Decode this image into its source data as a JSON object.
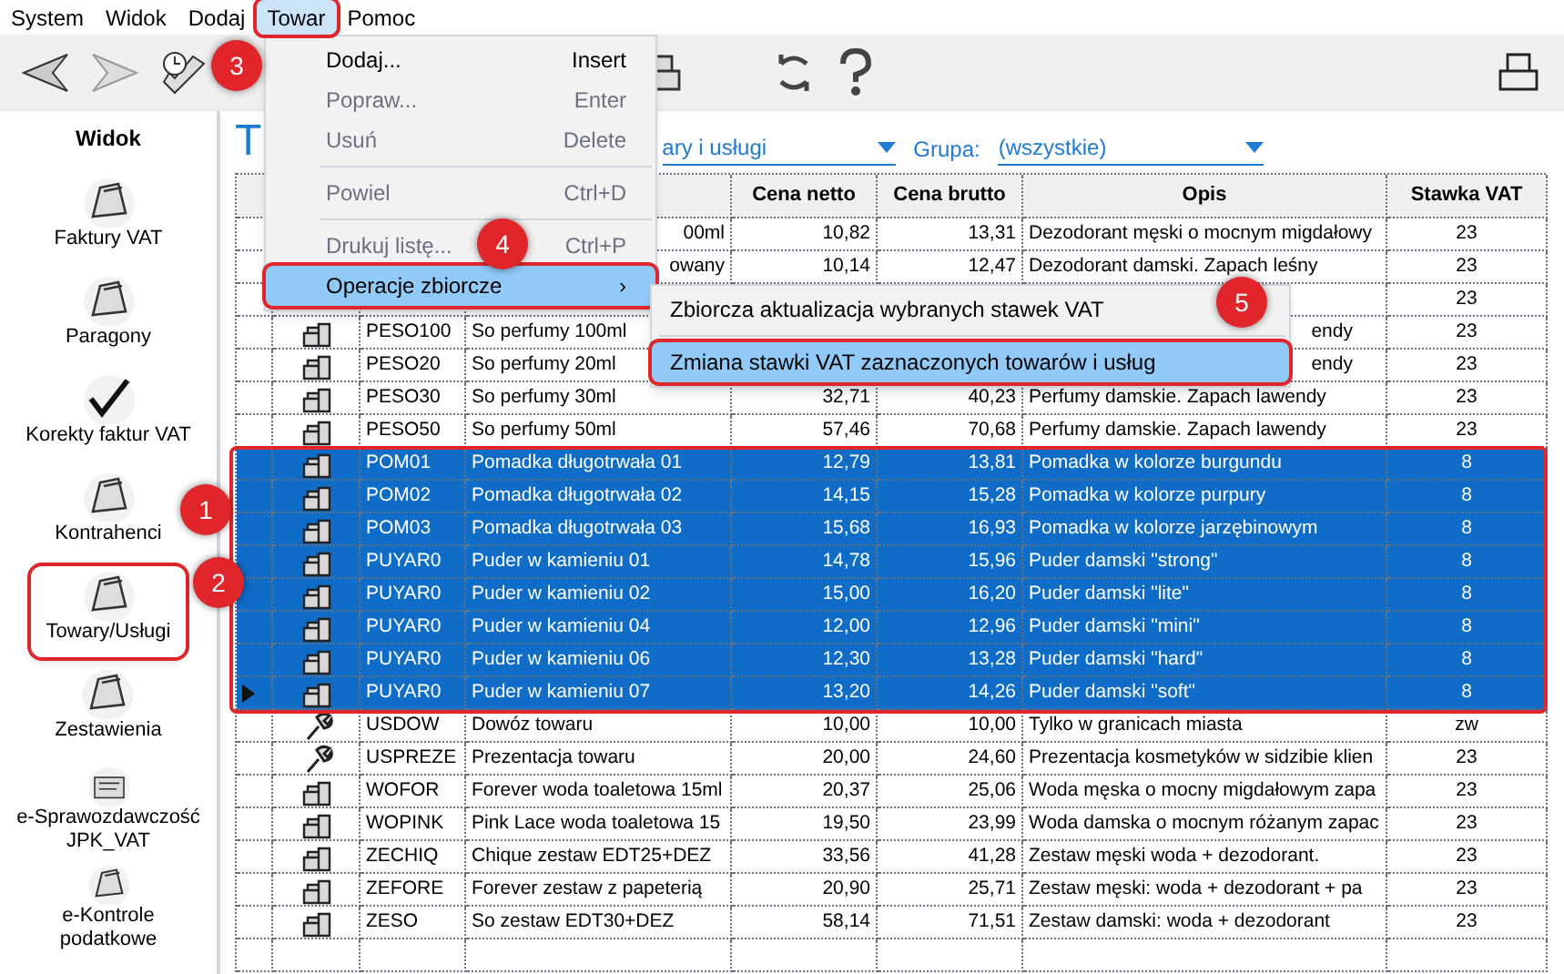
{
  "menubar": [
    {
      "label": "System",
      "selected": false
    },
    {
      "label": "Widok",
      "selected": false
    },
    {
      "label": "Dodaj",
      "selected": false
    },
    {
      "label": "Towar",
      "selected": true
    },
    {
      "label": "Pomoc",
      "selected": false
    }
  ],
  "sidebar": {
    "title": "Widok",
    "items": [
      {
        "label": "Faktury VAT",
        "selected": false
      },
      {
        "label": "Paragony",
        "selected": false
      },
      {
        "label": "Korekty faktur VAT",
        "selected": false
      },
      {
        "label": "Kontrahenci",
        "selected": false
      },
      {
        "label": "Towary/Usługi",
        "selected": true
      },
      {
        "label": "Zestawienia",
        "selected": false
      },
      {
        "label": "e-Sprawozdawczość JPK_VAT",
        "selected": false
      },
      {
        "label": "e-Kontrole podatkowe",
        "selected": false
      }
    ]
  },
  "view_title": "T",
  "filters": [
    {
      "value": "ary i usługi"
    },
    {
      "label": "Grupa:",
      "value": "(wszystkie)"
    }
  ],
  "table": {
    "columns": [
      "",
      "",
      "",
      "",
      "Cena netto",
      "Cena brutto",
      "Opis",
      "Stawka VAT"
    ],
    "rows": [
      {
        "name": "00ml",
        "netto": "10,82",
        "brutto": "13,31",
        "opis": "Dezodorant męski o mocnym migdałowy",
        "vat": "23",
        "selected": false,
        "current": false
      },
      {
        "name": "owany",
        "netto": "10,14",
        "brutto": "12,47",
        "opis": "Dezodorant damski. Zapach leśny",
        "vat": "23",
        "selected": false,
        "current": false
      },
      {
        "vat": "23",
        "selected": false,
        "current": false
      },
      {
        "kind": "product",
        "code": "PESO100",
        "name": "So perfumy 100ml",
        "opis": "endy",
        "vat": "23",
        "selected": false,
        "current": false
      },
      {
        "kind": "product",
        "code": "PESO20",
        "name": "So perfumy 20ml",
        "opis": "endy",
        "vat": "23",
        "selected": false,
        "current": false
      },
      {
        "kind": "product",
        "code": "PESO30",
        "name": "So perfumy 30ml",
        "netto": "32,71",
        "brutto": "40,23",
        "opis": "Perfumy damskie. Zapach lawendy",
        "vat": "23",
        "selected": false,
        "current": false
      },
      {
        "kind": "product",
        "code": "PESO50",
        "name": "So perfumy 50ml",
        "netto": "57,46",
        "brutto": "70,68",
        "opis": "Perfumy damskie. Zapach lawendy",
        "vat": "23",
        "selected": false,
        "current": false
      },
      {
        "kind": "product",
        "code": "POM01",
        "name": "Pomadka długotrwała 01",
        "netto": "12,79",
        "brutto": "13,81",
        "opis": "Pomadka w kolorze burgundu",
        "vat": "8",
        "selected": true,
        "current": false
      },
      {
        "kind": "product",
        "code": "POM02",
        "name": "Pomadka długotrwała 02",
        "netto": "14,15",
        "brutto": "15,28",
        "opis": "Pomadka w kolorze purpury",
        "vat": "8",
        "selected": true,
        "current": false
      },
      {
        "kind": "product",
        "code": "POM03",
        "name": "Pomadka długotrwała 03",
        "netto": "15,68",
        "brutto": "16,93",
        "opis": "Pomadka w kolorze jarzębinowym",
        "vat": "8",
        "selected": true,
        "current": false
      },
      {
        "kind": "product",
        "code": "PUYAR0",
        "name": "Puder w kamieniu 01",
        "netto": "14,78",
        "brutto": "15,96",
        "opis": "Puder damski \"strong\"",
        "vat": "8",
        "selected": true,
        "current": false
      },
      {
        "kind": "product",
        "code": "PUYAR0",
        "name": "Puder w kamieniu 02",
        "netto": "15,00",
        "brutto": "16,20",
        "opis": "Puder damski \"lite\"",
        "vat": "8",
        "selected": true,
        "current": false
      },
      {
        "kind": "product",
        "code": "PUYAR0",
        "name": "Puder w kamieniu 04",
        "netto": "12,00",
        "brutto": "12,96",
        "opis": "Puder damski \"mini\"",
        "vat": "8",
        "selected": true,
        "current": false
      },
      {
        "kind": "product",
        "code": "PUYAR0",
        "name": "Puder w kamieniu 06",
        "netto": "12,30",
        "brutto": "13,28",
        "opis": "Puder damski \"hard\"",
        "vat": "8",
        "selected": true,
        "current": false
      },
      {
        "kind": "product",
        "code": "PUYAR0",
        "name": "Puder w kamieniu 07",
        "netto": "13,20",
        "brutto": "14,26",
        "opis": "Puder damski \"soft\"",
        "vat": "8",
        "selected": true,
        "current": true
      },
      {
        "kind": "service",
        "code": "USDOW",
        "name": "Dowóz towaru",
        "netto": "10,00",
        "brutto": "10,00",
        "opis": "Tylko w granicach miasta",
        "vat": "zw",
        "selected": false,
        "current": false
      },
      {
        "kind": "service",
        "code": "USPREZE",
        "name": "Prezentacja towaru",
        "netto": "20,00",
        "brutto": "24,60",
        "opis": "Prezentacja kosmetyków w sidzibie klien",
        "vat": "23",
        "selected": false,
        "current": false
      },
      {
        "kind": "product",
        "code": "WOFOR",
        "name": "Forever woda toaletowa 15ml",
        "netto": "20,37",
        "brutto": "25,06",
        "opis": "Woda męska o mocny migdałowym zapa",
        "vat": "23",
        "selected": false,
        "current": false
      },
      {
        "kind": "product",
        "code": "WOPINK",
        "name": "Pink Lace woda toaletowa 15",
        "netto": "19,50",
        "brutto": "23,99",
        "opis": "Woda damska o mocnym różanym zapac",
        "vat": "23",
        "selected": false,
        "current": false
      },
      {
        "kind": "product",
        "code": "ZECHIQ",
        "name": "Chique zestaw EDT25+DEZ",
        "netto": "33,56",
        "brutto": "41,28",
        "opis": "Zestaw męski woda + dezodorant.",
        "vat": "23",
        "selected": false,
        "current": false
      },
      {
        "kind": "product",
        "code": "ZEFORE",
        "name": "Forever zestaw z papeterią",
        "netto": "20,90",
        "brutto": "25,71",
        "opis": "Zestaw męski: woda + dezodorant + pa",
        "vat": "23",
        "selected": false,
        "current": false
      },
      {
        "kind": "product",
        "code": "ZESO",
        "name": "So zestaw EDT30+DEZ",
        "netto": "58,14",
        "brutto": "71,51",
        "opis": "Zestaw damski: woda + dezodorant",
        "vat": "23",
        "selected": false,
        "current": false
      },
      {
        "selected": false,
        "current": false
      }
    ]
  },
  "menu": {
    "items": [
      {
        "kind": "item",
        "label": "Dodaj...",
        "shortcut": "Insert",
        "disabled": false,
        "selected": false
      },
      {
        "kind": "item",
        "label": "Popraw...",
        "shortcut": "Enter",
        "disabled": true,
        "selected": false
      },
      {
        "kind": "item",
        "label": "Usuń",
        "shortcut": "Delete",
        "disabled": true,
        "selected": false
      },
      {
        "kind": "separator"
      },
      {
        "kind": "item",
        "label": "Powiel",
        "shortcut": "Ctrl+D",
        "disabled": true,
        "selected": false
      },
      {
        "kind": "separator"
      },
      {
        "kind": "item",
        "label": "Drukuj listę...",
        "shortcut": "Ctrl+P",
        "disabled": true,
        "selected": false
      },
      {
        "kind": "submenu",
        "label": "Operacje zbiorcze",
        "shortcut": "›",
        "disabled": false,
        "selected": true
      }
    ]
  },
  "submenu": {
    "items": [
      {
        "kind": "item",
        "label": "Zbiorcza aktualizacja wybranych stawek VAT",
        "selected": false
      },
      {
        "kind": "separator"
      },
      {
        "kind": "item",
        "label": "Zmiana stawki VAT zaznaczonych towarów i usług",
        "selected": true
      }
    ]
  },
  "callouts": [
    "1",
    "2",
    "3",
    "4",
    "5"
  ]
}
